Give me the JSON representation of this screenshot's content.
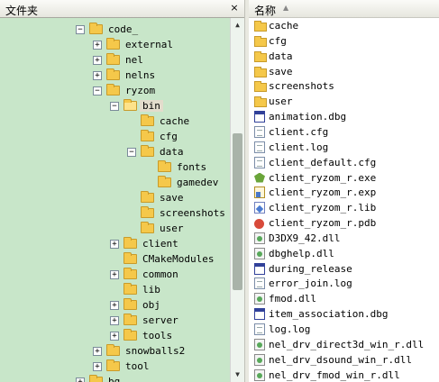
{
  "left_pane": {
    "title": "文件夹",
    "close_glyph": "×",
    "tree": [
      {
        "label": "code_",
        "depth": 0,
        "expander": "−",
        "open": false,
        "icon": "folder-icon"
      },
      {
        "label": "external",
        "depth": 1,
        "expander": "+",
        "open": false,
        "icon": "folder-icon"
      },
      {
        "label": "nel",
        "depth": 1,
        "expander": "+",
        "open": false,
        "icon": "folder-icon"
      },
      {
        "label": "nelns",
        "depth": 1,
        "expander": "+",
        "open": false,
        "icon": "folder-icon"
      },
      {
        "label": "ryzom",
        "depth": 1,
        "expander": "−",
        "open": false,
        "icon": "folder-icon"
      },
      {
        "label": "bin",
        "depth": 2,
        "expander": "−",
        "open": true,
        "icon": "folder-open-icon",
        "selected": true
      },
      {
        "label": "cache",
        "depth": 3,
        "expander": "",
        "open": false,
        "icon": "folder-icon"
      },
      {
        "label": "cfg",
        "depth": 3,
        "expander": "",
        "open": false,
        "icon": "folder-icon"
      },
      {
        "label": "data",
        "depth": 3,
        "expander": "−",
        "open": false,
        "icon": "folder-icon"
      },
      {
        "label": "fonts",
        "depth": 4,
        "expander": "",
        "open": false,
        "icon": "folder-icon"
      },
      {
        "label": "gamedev",
        "depth": 4,
        "expander": "",
        "open": false,
        "icon": "folder-icon"
      },
      {
        "label": "save",
        "depth": 3,
        "expander": "",
        "open": false,
        "icon": "folder-icon"
      },
      {
        "label": "screenshots",
        "depth": 3,
        "expander": "",
        "open": false,
        "icon": "folder-icon"
      },
      {
        "label": "user",
        "depth": 3,
        "expander": "",
        "open": false,
        "icon": "folder-icon"
      },
      {
        "label": "client",
        "depth": 2,
        "expander": "+",
        "open": false,
        "icon": "folder-icon"
      },
      {
        "label": "CMakeModules",
        "depth": 2,
        "expander": "",
        "open": false,
        "icon": "folder-icon"
      },
      {
        "label": "common",
        "depth": 2,
        "expander": "+",
        "open": false,
        "icon": "folder-icon"
      },
      {
        "label": "lib",
        "depth": 2,
        "expander": "",
        "open": false,
        "icon": "folder-icon"
      },
      {
        "label": "obj",
        "depth": 2,
        "expander": "+",
        "open": false,
        "icon": "folder-icon"
      },
      {
        "label": "server",
        "depth": 2,
        "expander": "+",
        "open": false,
        "icon": "folder-icon"
      },
      {
        "label": "tools",
        "depth": 2,
        "expander": "+",
        "open": false,
        "icon": "folder-icon"
      },
      {
        "label": "snowballs2",
        "depth": 1,
        "expander": "+",
        "open": false,
        "icon": "folder-icon"
      },
      {
        "label": "tool",
        "depth": 1,
        "expander": "+",
        "open": false,
        "icon": "folder-icon"
      },
      {
        "label": "bg",
        "depth": 0,
        "expander": "+",
        "open": false,
        "icon": "folder-icon"
      }
    ],
    "scrollbar": {
      "up_glyph": "▲",
      "down_glyph": "▼",
      "thumb_start": 0.3,
      "thumb_size": 0.47
    }
  },
  "right_pane": {
    "column_header": "名称",
    "sort_glyph": "▲",
    "files": [
      {
        "name": "cache",
        "type": "folder"
      },
      {
        "name": "cfg",
        "type": "folder"
      },
      {
        "name": "data",
        "type": "folder"
      },
      {
        "name": "save",
        "type": "folder"
      },
      {
        "name": "screenshots",
        "type": "folder"
      },
      {
        "name": "user",
        "type": "folder"
      },
      {
        "name": "animation.dbg",
        "type": "dbg"
      },
      {
        "name": "client.cfg",
        "type": "doc"
      },
      {
        "name": "client.log",
        "type": "doc"
      },
      {
        "name": "client_default.cfg",
        "type": "doc"
      },
      {
        "name": "client_ryzom_r.exe",
        "type": "exe"
      },
      {
        "name": "client_ryzom_r.exp",
        "type": "exp"
      },
      {
        "name": "client_ryzom_r.lib",
        "type": "lib"
      },
      {
        "name": "client_ryzom_r.pdb",
        "type": "pdb"
      },
      {
        "name": "D3DX9_42.dll",
        "type": "dll"
      },
      {
        "name": "dbghelp.dll",
        "type": "dll"
      },
      {
        "name": "during_release",
        "type": "dbg"
      },
      {
        "name": "error_join.log",
        "type": "doc"
      },
      {
        "name": "fmod.dll",
        "type": "dll"
      },
      {
        "name": "item_association.dbg",
        "type": "dbg"
      },
      {
        "name": "log.log",
        "type": "doc"
      },
      {
        "name": "nel_drv_direct3d_win_r.dll",
        "type": "dll"
      },
      {
        "name": "nel_drv_dsound_win_r.dll",
        "type": "dll"
      },
      {
        "name": "nel_drv_fmod_win_r.dll",
        "type": "dll"
      }
    ]
  }
}
